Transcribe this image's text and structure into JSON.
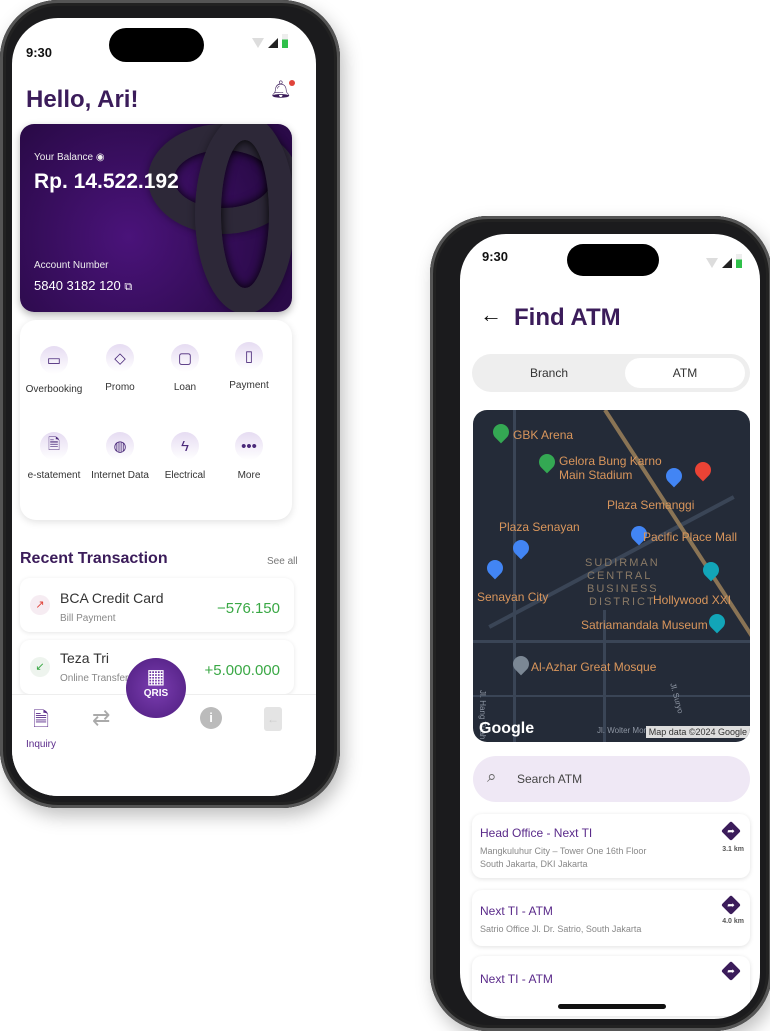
{
  "left_phone": {
    "status_time": "9:30",
    "greeting": "Hello, Ari!",
    "card": {
      "balance_label": "Your Balance",
      "balance": "Rp. 14.522.192",
      "account_label": "Account Number",
      "account_number": "5840 3182 120"
    },
    "menu": [
      {
        "label": "Overbooking",
        "icon": "transfer-card-icon"
      },
      {
        "label": "Promo",
        "icon": "tag-icon"
      },
      {
        "label": "Loan",
        "icon": "wallet-icon"
      },
      {
        "label": "Payment",
        "icon": "receipt-icon"
      },
      {
        "label": "e-statement",
        "icon": "document-search-icon"
      },
      {
        "label": "Internet Data",
        "icon": "globe-icon"
      },
      {
        "label": "Electrical",
        "icon": "lightning-icon"
      },
      {
        "label": "More",
        "icon": "more-icon"
      }
    ],
    "recent": {
      "title": "Recent Transaction",
      "see_all": "See all",
      "items": [
        {
          "name": "BCA Credit Card",
          "type": "Bill Payment",
          "amount": "−576.150",
          "direction": "out"
        },
        {
          "name": "Teza Tri",
          "type": "Online Transfer",
          "amount": "+5.000.000",
          "direction": "in"
        }
      ]
    },
    "nav": {
      "inquiry": "Inquiry",
      "qris": "QRIS"
    }
  },
  "right_phone": {
    "status_time": "9:30",
    "title": "Find ATM",
    "tabs": [
      {
        "label": "Branch",
        "active": false
      },
      {
        "label": "ATM",
        "active": true
      }
    ],
    "map": {
      "labels": [
        "GBK Arena",
        "Gelora Bung Karno",
        "Main Stadium",
        "Plaza Semanggi",
        "Plaza Senayan",
        "Pacific Place Mall",
        "SUDIRMAN",
        "CENTRAL",
        "BUSINESS",
        "DISTRICT",
        "Senayan City",
        "Hollywood XXI",
        "Satriamandala Museum",
        "Al-Azhar Great Mosque",
        "Jl. Hang Tuah Raya",
        "Jl. Suryo",
        "Jl. Wolter Monginsidi"
      ],
      "google": "Google",
      "attribution": "Map data ©2024 Google"
    },
    "search_placeholder": "Search ATM",
    "locations": [
      {
        "name": "Head Office - Next TI",
        "address1": "Mangkuluhur City – Tower One 16th Floor",
        "address2": "South Jakarta, DKI Jakarta",
        "distance": "3.1 km"
      },
      {
        "name": "Next TI - ATM",
        "address1": "Satrio Office Jl. Dr. Satrio, South Jakarta",
        "distance": "4.0 km"
      },
      {
        "name": "Next TI - ATM"
      }
    ]
  },
  "colors": {
    "primary": "#3b1c5a",
    "accent": "#6a2c91",
    "positive": "#3aa845",
    "negative": "#e0443a",
    "search_bg": "#efe8f5"
  }
}
